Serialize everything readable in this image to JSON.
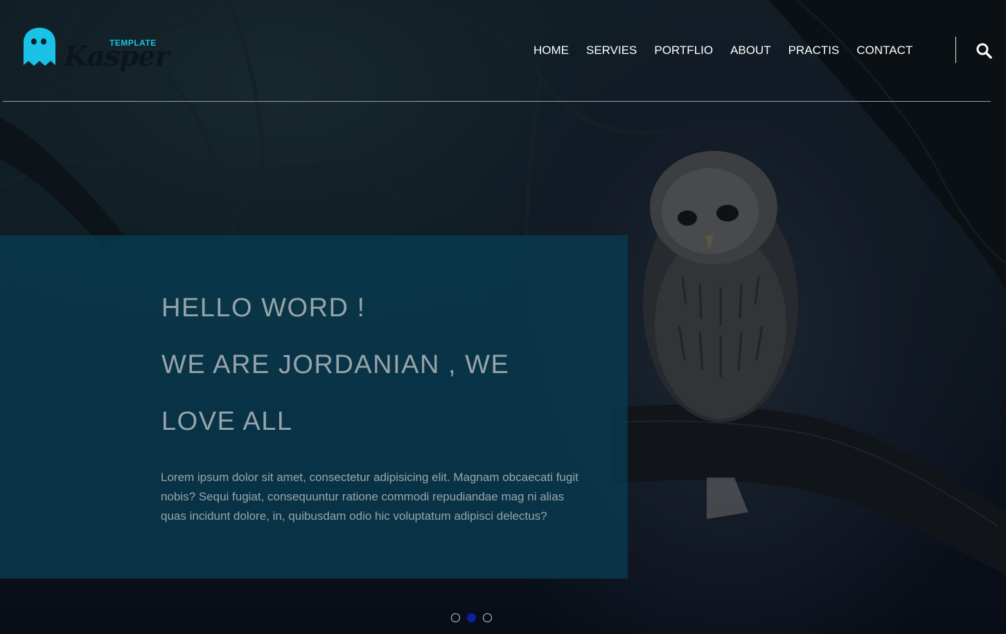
{
  "header": {
    "logo": {
      "tagline": "TEMPLATE",
      "name": "Kasper",
      "ghost_color": "#19c2e6"
    },
    "nav": [
      {
        "label": "HOME"
      },
      {
        "label": "SERVIES"
      },
      {
        "label": "PORTFLIO"
      },
      {
        "label": "ABOUT"
      },
      {
        "label": "PRACTIS"
      },
      {
        "label": "CONTACT"
      }
    ],
    "search_icon": "search-icon"
  },
  "hero": {
    "headline_lines": [
      "HELLO WORD !",
      "WE ARE JORDANIAN , WE",
      "LOVE ALL"
    ],
    "body": "Lorem ipsum dolor sit amet, consectetur adipisicing elit. Magnam obcaecati fugit nobis? Sequi fugiat, consequuntur ratione commodi repudiandae mag ni alias quas incidunt dolore, in, quibusdam odio hic voluptatum adipisci delectus?",
    "panel_color": "#083c52",
    "background_image": "owl-on-branch-at-night"
  },
  "slider": {
    "dots": 3,
    "active_index": 1,
    "active_color": "#0b1fa6"
  }
}
